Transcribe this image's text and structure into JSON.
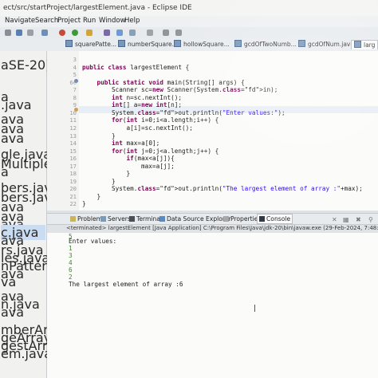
{
  "window": {
    "title": "ect/src/startProject/largestElement.java - Eclipse IDE"
  },
  "menu": [
    "Navigate",
    "Search",
    "Project",
    "Run",
    "Window",
    "Help"
  ],
  "editor_tabs": [
    {
      "label": "squarePatte..."
    },
    {
      "label": "numberSquare..."
    },
    {
      "label": "hollowSquare..."
    },
    {
      "label": "gcdOfTwoNumb..."
    },
    {
      "label": "gcdOfNum.java"
    },
    {
      "label": "larg"
    }
  ],
  "explorer": {
    "items": [
      "aSE-20]",
      "a",
      ".java",
      "ava",
      "ava",
      "ava",
      "gle.java",
      "Multiples.java",
      "a",
      "bers.java",
      "bers.java",
      "ava",
      "ava",
      "ava",
      "c.java",
      "ava",
      "rs.java",
      "les.java",
      "nPattern.java",
      "ava",
      "va",
      "ava",
      "n.java",
      "ava",
      "mberArray.java",
      "geArray.java",
      "gestArray.java",
      "em.java"
    ],
    "selected_index": 14
  },
  "code": {
    "line_numbers": [
      "3",
      "4",
      "5",
      "6⊖",
      "7",
      "8",
      "9",
      "10",
      "11",
      "12",
      "13",
      "14",
      "15",
      "16",
      "17",
      "18",
      "19",
      "20",
      "21",
      "22"
    ],
    "lines": [
      "",
      "public class largestElement {",
      "",
      "    public static void main(String[] args) {",
      "        Scanner sc=new Scanner(System.in);",
      "        int n=sc.nextInt();",
      "        int[] a=new int[n];",
      "        System.out.println(\"Enter values:\");",
      "        for(int i=0;i<a.length;i++) {",
      "            a[i]=sc.nextInt();",
      "        }",
      "        int max=a[0];",
      "        for(int j=0;j<a.length;j++) {",
      "            if(max<a[j]){",
      "                max=a[j];",
      "            }",
      "        }",
      "        System.out.println(\"The largest element of array :\"+max);",
      "    }",
      "}"
    ]
  },
  "view_tabs": [
    "Problems",
    "Servers",
    "Terminal",
    "Data Source Explorer",
    "Properties",
    "Console"
  ],
  "active_view_tab": "Console",
  "console": {
    "terminated_line": "<terminated> largestElement [Java Application] C:\\Program Files\\Java\\jdk-20\\bin\\javaw.exe  (29-Feb-2024, 7:48:09 pm – 7:48:21 p",
    "first_input": "5",
    "prompt": "Enter values:",
    "inputs": [
      "1",
      "3",
      "4",
      "6",
      "2"
    ],
    "result": "The largest element of array :6"
  },
  "colors": {
    "keyword": "#7f0055",
    "string": "#2a00ff",
    "field": "#0000c0",
    "console_input": "#3a8a2a"
  }
}
